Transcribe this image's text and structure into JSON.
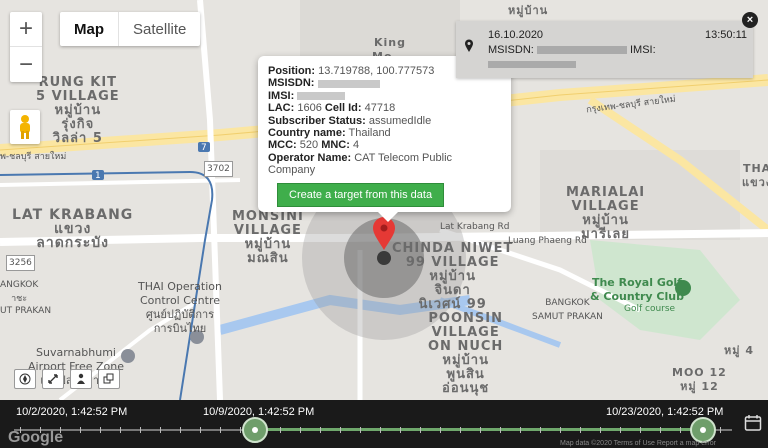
{
  "map_type": {
    "map": "Map",
    "satellite": "Satellite"
  },
  "zoom": {
    "in": "+",
    "out": "−"
  },
  "labels": {
    "rung_kit": "RUNG KIT\n5 VILLAGE\nหมู่บ้าน\nรุ่งกิจ\nวิลล่า 5",
    "king": "King\nMo...",
    "lat_krabang": "LAT KRABANG\nแขวง\nลาดกระบัง",
    "monsini": "MONSINI\nVILLAGE\nหมู่บ้าน\nมณสิน",
    "chinda": "CHINDA NIWET\n99 VILLAGE\nหมู่บ้าน\nจินดา\nนิเวศน์ 99",
    "mariali": "MARIALAI\nVILLAGE\nหมู่บ้าน\nมารีเลย",
    "poonsin": "POONSIN\nVILLAGE\nON NUCH\nหมู่บ้าน\nพูนสิน\nอ่อนนุช",
    "thai_op": "THAI Operation\nControl Centre\nศูนย์ปฏิบัติการ\nการบินไทย",
    "suvarnabhumi": "Suvarnabhumi\nAirport Free Zone\nเขตปลอดอากร",
    "royal_golf": "The Royal Golf\n& Country Club",
    "golf_course": "Golf course",
    "bangkok_samut": "BANGKOK\nSAMUT PRAKAN",
    "lat_krabang_rd": "Lat Krabang Rd",
    "luang_phaeng": "Luang Phaeng Rd",
    "moo4": "หมู่ 4",
    "moo12": "MOO 12\nหมู่ 12",
    "tha": "THA\nแขวง",
    "moo_top": "หมู่บ้าน",
    "bangkok_road_th": "กรุงเทพ-ชลบุรี สายใหม่",
    "chonburi_left": "พ-ชลบุรี สายใหม่",
    "angkok": "ANGKOK\nาชะ",
    "t_prakan": "UT PRAKAN",
    "route_3256": "3256",
    "route_3702": "3702",
    "route_7": "7",
    "route_1": "1"
  },
  "popup": {
    "position_label": "Position:",
    "position_value": "13.719788, 100.777573",
    "msisdn_label": "MSISDN:",
    "imsi_label": "IMSI:",
    "lac_label": "LAC:",
    "lac_value": "1606",
    "cell_label": "Cell Id:",
    "cell_value": "47718",
    "status_label": "Subscriber Status:",
    "status_value": "assumedIdle",
    "country_label": "Country name:",
    "country_value": "Thailand",
    "mcc_label": "MCC:",
    "mcc_value": "520",
    "mnc_label": "MNC:",
    "mnc_value": "4",
    "operator_label": "Operator Name:",
    "operator_value": "CAT Telecom Public Company",
    "button": "Create a target from this data"
  },
  "notification": {
    "date": "16.10.2020",
    "time": "13:50:11",
    "msisdn_label": "MSISDN:",
    "imsi_label": "IMSI:",
    "close": "×"
  },
  "timeline": {
    "start": "10/2/2020, 1:42:52 PM",
    "left_handle": "10/9/2020, 1:42:52 PM",
    "right_handle": "10/23/2020, 1:42:52 PM"
  },
  "footer": {
    "google": "Google",
    "attribution": "Map data ©2020   Terms of Use   Report a map error"
  },
  "colors": {
    "button_green": "#3fae4b",
    "pin_red": "#e53935",
    "timeline_bg": "#1a1a1a",
    "slider_green": "#6fa86c"
  }
}
